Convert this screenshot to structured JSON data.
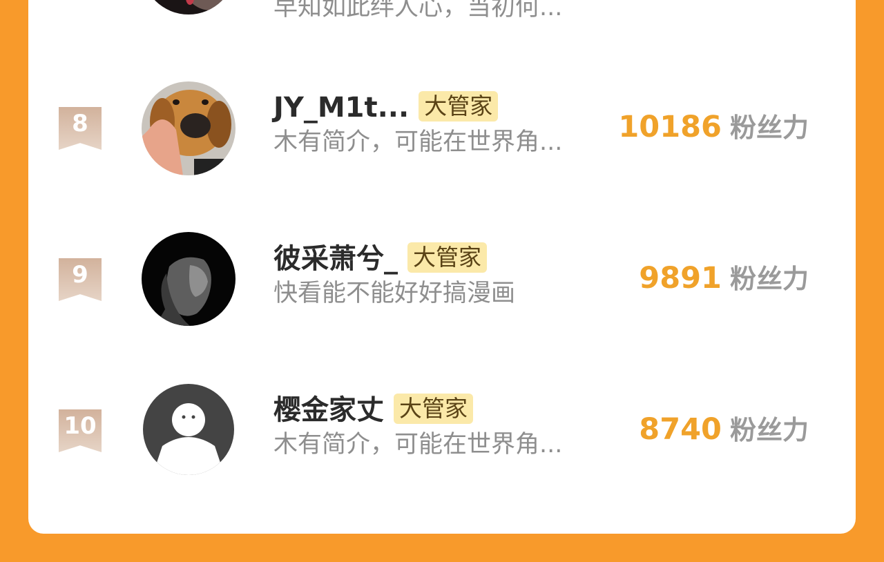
{
  "rows": [
    {
      "rank": "",
      "name": "",
      "badge": "",
      "bio": "早知如此绊人心，当初何...",
      "score": "",
      "unit": "",
      "avatar_icon": "dark-partial-avatar"
    },
    {
      "rank": "8",
      "name": "JY_M1t...",
      "badge": "大管家",
      "bio": "木有简介，可能在世界角...",
      "score": "10186",
      "unit": "粉丝力",
      "avatar_icon": "dog-avatar"
    },
    {
      "rank": "9",
      "name": "彼采萧兮_",
      "badge": "大管家",
      "bio": "快看能不能好好搞漫画",
      "score": "9891",
      "unit": "粉丝力",
      "avatar_icon": "lion-avatar"
    },
    {
      "rank": "10",
      "name": "樱金家丈",
      "badge": "大管家",
      "bio": "木有简介，可能在世界角...",
      "score": "8740",
      "unit": "粉丝力",
      "avatar_icon": "default-user-avatar"
    }
  ],
  "colors": {
    "background": "#f89a2b",
    "card": "#ffffff",
    "score": "#f0a22a",
    "badge_bg": "#fbe9a9",
    "rank_badge": "#d2b29c"
  }
}
